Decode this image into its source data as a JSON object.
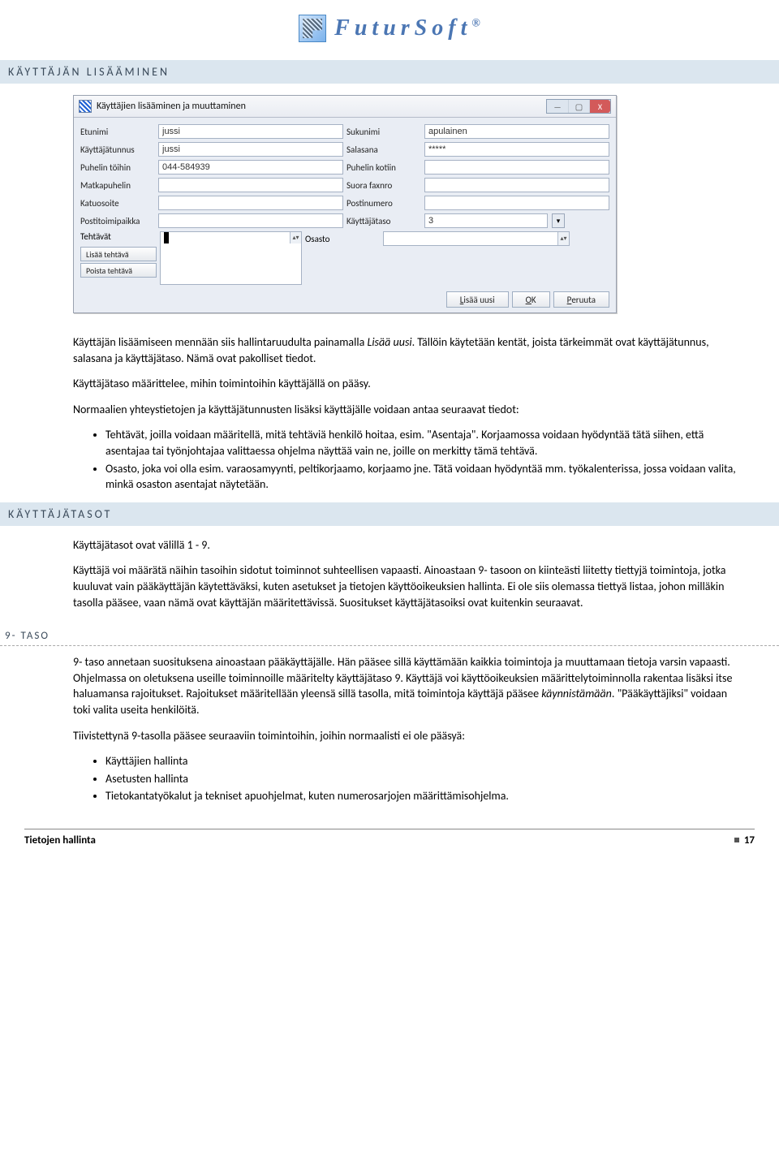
{
  "logo": {
    "text": "FuturSoft",
    "reg": "®"
  },
  "headings": {
    "add_user": "KÄYTTÄJÄN LISÄÄMINEN",
    "levels": "KÄYTTÄJÄTASOT",
    "level9": "9- TASO"
  },
  "window": {
    "title": "Käyttäjien lisääminen ja muuttaminen",
    "buttons": {
      "min": "—",
      "max": "▢",
      "close": "X"
    },
    "labels": {
      "firstname": "Etunimi",
      "lastname": "Sukunimi",
      "username": "Käyttäjätunnus",
      "password": "Salasana",
      "workphone": "Puhelin töihin",
      "homephone": "Puhelin kotiin",
      "mobile": "Matkapuhelin",
      "fax": "Suora faxnro",
      "street": "Katuosoite",
      "postcode": "Postinumero",
      "city": "Postitoimipaikka",
      "level": "Käyttäjätaso",
      "tasks": "Tehtävät",
      "dept": "Osasto"
    },
    "values": {
      "firstname": "jussi",
      "lastname": "apulainen",
      "username": "jussi",
      "password": "*****",
      "workphone": "044-584939",
      "homephone": "",
      "mobile": "",
      "fax": "",
      "street": "",
      "postcode": "",
      "city": "",
      "level": "3",
      "dept": ""
    },
    "task_buttons": {
      "add": "Lisää tehtävä",
      "remove": "Poista tehtävä"
    },
    "footer": {
      "addnew": "Lisää uusi",
      "ok": "OK",
      "cancel": "Peruuta",
      "ok_u": "O",
      "ok_rest": "K",
      "cancel_u": "P",
      "cancel_rest": "eruuta",
      "add_u": "L",
      "add_rest": "isää uusi"
    }
  },
  "para": {
    "p1a": "Käyttäjän lisäämiseen mennään siis hallintaruudulta painamalla ",
    "p1b": "Lisää uusi",
    "p1c": ". Tällöin käytetään kentät, joista tärkeimmät ovat käyttäjätunnus, salasana ja käyttäjätaso. Nämä ovat pakolliset tiedot.",
    "p2": "Käyttäjätaso määrittelee, mihin toimintoihin käyttäjällä on pääsy.",
    "p3": "Normaalien yhteystietojen ja käyttäjätunnusten lisäksi käyttäjälle voidaan antaa seuraavat tiedot:",
    "b1": "Tehtävät, joilla voidaan määritellä, mitä tehtäviä henkilö hoitaa, esim. \"Asentaja\". Korjaamossa voidaan hyödyntää tätä siihen, että asentajaa tai työnjohtajaa valittaessa ohjelma näyttää vain ne, joille on merkitty tämä tehtävä.",
    "b2": "Osasto, joka voi olla esim. varaosamyynti, peltikorjaamo, korjaamo jne. Tätä voidaan hyödyntää mm. työkalenterissa, jossa voidaan valita, minkä osaston asentajat näytetään.",
    "levels_p1": "Käyttäjätasot ovat välillä 1 - 9.",
    "levels_p2": "Käyttäjä voi määrätä näihin tasoihin sidotut toiminnot suhteellisen vapaasti. Ainoastaan 9- tasoon on kiinteästi liitetty tiettyjä toimintoja, jotka kuuluvat vain pääkäyttäjän käytettäväksi, kuten asetukset ja tietojen käyttöoikeuksien hallinta. Ei ole siis olemassa tiettyä listaa, johon milläkin tasolla pääsee, vaan nämä ovat käyttäjän määritettävissä. Suositukset käyttäjätasoiksi ovat kuitenkin seuraavat.",
    "l9_p1a": "9- taso annetaan suosituksena ainoastaan pääkäyttäjälle. Hän pääsee sillä käyttämään kaikkia toimintoja ja muuttamaan tietoja varsin vapaasti. Ohjelmassa on oletuksena useille toiminnoille määritelty käyttäjätaso 9. Käyttäjä voi käyttöoikeuksien määrittelytoiminnolla rakentaa lisäksi itse haluamansa rajoitukset. Rajoitukset määritellään yleensä sillä tasolla, mitä toimintoja käyttäjä pääsee ",
    "l9_p1b": "käynnistämään",
    "l9_p1c": ". \"Pääkäyttäjiksi\" voidaan toki valita useita henkilöitä.",
    "l9_p2": "Tiivistettynä 9-tasolla pääsee seuraaviin toimintoihin, joihin normaalisti ei ole pääsyä:",
    "l9_b1": "Käyttäjien hallinta",
    "l9_b2": "Asetusten hallinta",
    "l9_b3": "Tietokantatyökalut ja tekniset apuohjelmat, kuten numerosarjojen määrittämisohjelma."
  },
  "footer": {
    "section": "Tietojen hallinta",
    "page": "17"
  }
}
